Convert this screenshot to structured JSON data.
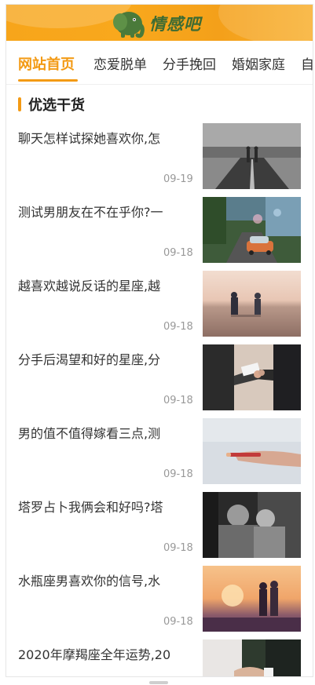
{
  "header": {
    "logo_text": "情感吧",
    "brand_color": "#f9a81c",
    "logo_icon": "elephant-icon"
  },
  "nav": {
    "items": [
      {
        "label": "网站首页",
        "active": true
      },
      {
        "label": "恋爱脱单",
        "active": false
      },
      {
        "label": "分手挽回",
        "active": false
      },
      {
        "label": "婚姻家庭",
        "active": false
      },
      {
        "label": "自",
        "active": false
      }
    ],
    "accent_color": "#f39a14"
  },
  "section": {
    "title": "优选干货"
  },
  "articles": [
    {
      "title": "聊天怎样试探她喜欢你,怎",
      "date": "09-19",
      "image": "couple-on-road"
    },
    {
      "title": "测试男朋友在不在乎你?一",
      "date": "09-18",
      "image": "car-couple-rain"
    },
    {
      "title": "越喜欢越说反话的星座,越",
      "date": "09-18",
      "image": "couple-on-beach"
    },
    {
      "title": "分手后渴望和好的星座,分",
      "date": "09-18",
      "image": "handing-letter"
    },
    {
      "title": "男的值不值得嫁看三点,测",
      "date": "09-18",
      "image": "hand-with-cigarette"
    },
    {
      "title": "塔罗占卜我俩会和好吗?塔",
      "date": "09-18",
      "image": "couple-black-white"
    },
    {
      "title": "水瓶座男喜欢你的信号,水",
      "date": "09-18",
      "image": "couple-sunset"
    },
    {
      "title": "2020年摩羯座全年运势,20",
      "date": "",
      "image": "holding-hands"
    }
  ]
}
